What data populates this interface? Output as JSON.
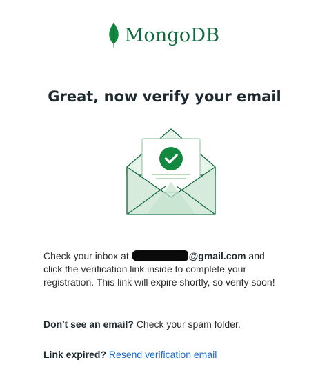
{
  "brand": {
    "name": "MongoDB",
    "mark": "."
  },
  "headline": "Great, now verify your email",
  "illustration": {
    "icon": "envelope-checkmark-icon"
  },
  "inbox_notice": {
    "prefix": "Check your inbox at",
    "email_domain": "@gmail.com",
    "suffix": "and click the verification link inside to complete your registration. This link will expire shortly, so verify soon!"
  },
  "spam_notice": {
    "question": "Don't see an email?",
    "answer": "Check your spam folder."
  },
  "expired_notice": {
    "question": "Link expired?",
    "link_label": "Resend verification email"
  },
  "colors": {
    "brand_green": "#13693e",
    "link_blue": "#1a6bd1",
    "check_green": "#13883f"
  }
}
